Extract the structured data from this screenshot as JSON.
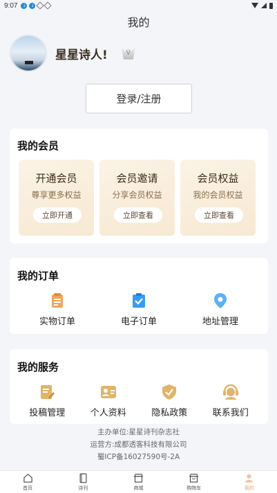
{
  "status_bar": {
    "time": "9:07",
    "icons": [
      "notification-icon",
      "notification-icon",
      "cube-icon",
      "cube-icon",
      "wifi-icon",
      "signal-icon",
      "battery-icon"
    ]
  },
  "header": {
    "title": "我的"
  },
  "profile": {
    "username": "星星诗人!",
    "badge_icon": "vip-crown-icon"
  },
  "login_button": "登录/注册",
  "membership": {
    "title": "我的会员",
    "tiles": [
      {
        "title": "开通会员",
        "subtitle": "尊享更多权益",
        "button": "立即开通"
      },
      {
        "title": "会员邀请",
        "subtitle": "分享会员权益",
        "button": "立即查看"
      },
      {
        "title": "会员权益",
        "subtitle": "我的会员权益",
        "button": "立即查看"
      }
    ]
  },
  "orders": {
    "title": "我的订单",
    "items": [
      {
        "label": "实物订单",
        "icon": "order-list-icon"
      },
      {
        "label": "电子订单",
        "icon": "clipboard-check-icon"
      },
      {
        "label": "地址管理",
        "icon": "location-pin-icon"
      }
    ]
  },
  "services": {
    "title": "我的服务",
    "items": [
      {
        "label": "投稿管理",
        "icon": "edit-document-icon"
      },
      {
        "label": "个人资料",
        "icon": "id-card-icon"
      },
      {
        "label": "隐私政策",
        "icon": "shield-check-icon"
      },
      {
        "label": "联系我们",
        "icon": "customer-service-icon"
      }
    ]
  },
  "footer": {
    "line1": "主办单位:星星诗刊杂志社",
    "line2": "运营方:成都透客科技有限公司",
    "line3": "蜀ICP备16027590号-2A"
  },
  "tabbar": {
    "items": [
      {
        "label": "首页",
        "icon": "home-icon"
      },
      {
        "label": "诗刊",
        "icon": "book-icon"
      },
      {
        "label": "商城",
        "icon": "shop-icon"
      },
      {
        "label": "购物车",
        "icon": "cart-icon"
      },
      {
        "label": "我的",
        "icon": "user-icon",
        "active": true
      }
    ]
  },
  "colors": {
    "accent": "#e5a572",
    "vip_tile_bg": "#f8ecd9",
    "location_blue": "#3a9bf0"
  }
}
